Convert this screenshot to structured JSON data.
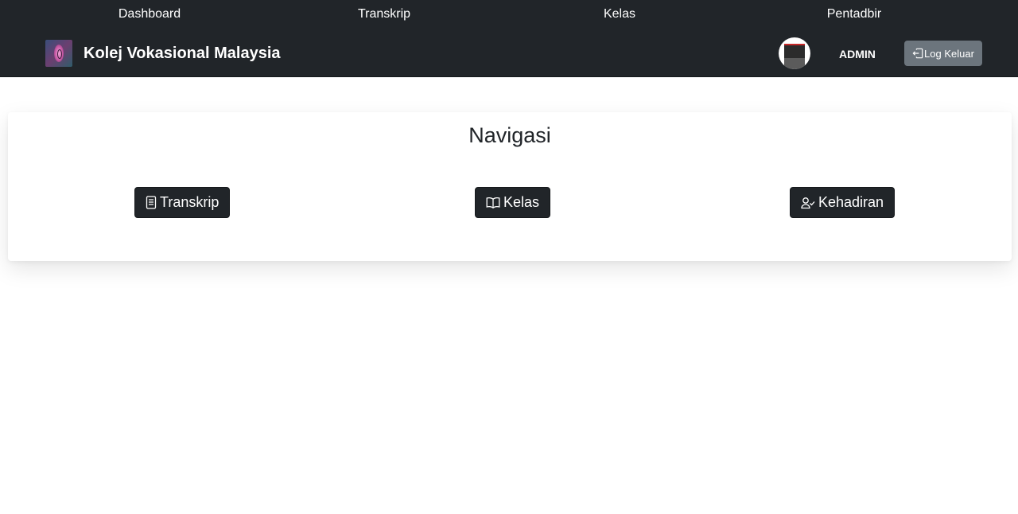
{
  "top_nav": {
    "links": [
      {
        "label": "Dashboard"
      },
      {
        "label": "Transkrip"
      },
      {
        "label": "Kelas"
      },
      {
        "label": "Pentadbir"
      }
    ]
  },
  "brand": {
    "title": "Kolej Vokasional Malaysia",
    "logo_icon": "college-logo"
  },
  "user": {
    "name": "ADMIN",
    "avatar_icon": "user-avatar"
  },
  "logout": {
    "label": "Log Keluar",
    "icon": "logout-icon"
  },
  "navigation_card": {
    "title": "Navigasi",
    "buttons": [
      {
        "label": "Transkrip",
        "icon": "document-icon"
      },
      {
        "label": "Kelas",
        "icon": "book-icon"
      },
      {
        "label": "Kehadiran",
        "icon": "person-check-icon"
      }
    ]
  },
  "colors": {
    "navbar_bg": "#212529",
    "button_dark": "#212529",
    "button_secondary": "#6c757d",
    "text_light": "#ffffff"
  }
}
